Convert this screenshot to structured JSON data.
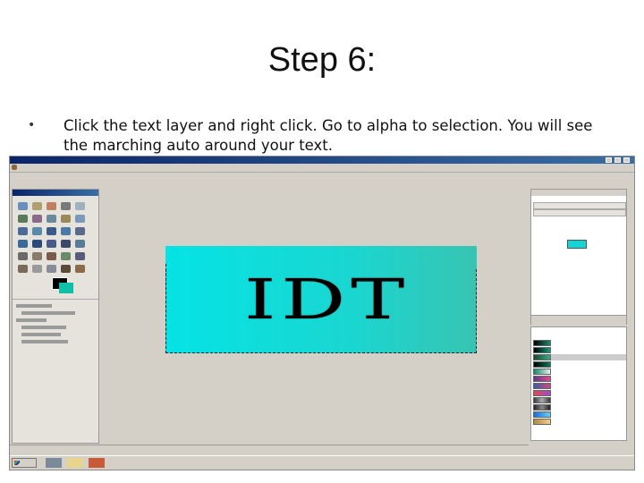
{
  "slide": {
    "title": "Step 6:",
    "bullet_symbol": "•",
    "bullet_text": "Click the text layer and right click. Go to alpha to selection. You will see the marching auto around your text."
  },
  "gimp": {
    "image_text": "IDT",
    "accent_colors": {
      "image_gradient_start": "#05e3e4",
      "image_gradient_end": "#38c4b2",
      "titlebar": "#0a246a",
      "window_bg": "#d4d0c8"
    }
  },
  "icons": [
    "gimp-logo-icon",
    "tool-icon",
    "minimize-icon",
    "maximize-icon",
    "close-icon",
    "windows-flag-icon",
    "taskbar-app-icon"
  ]
}
